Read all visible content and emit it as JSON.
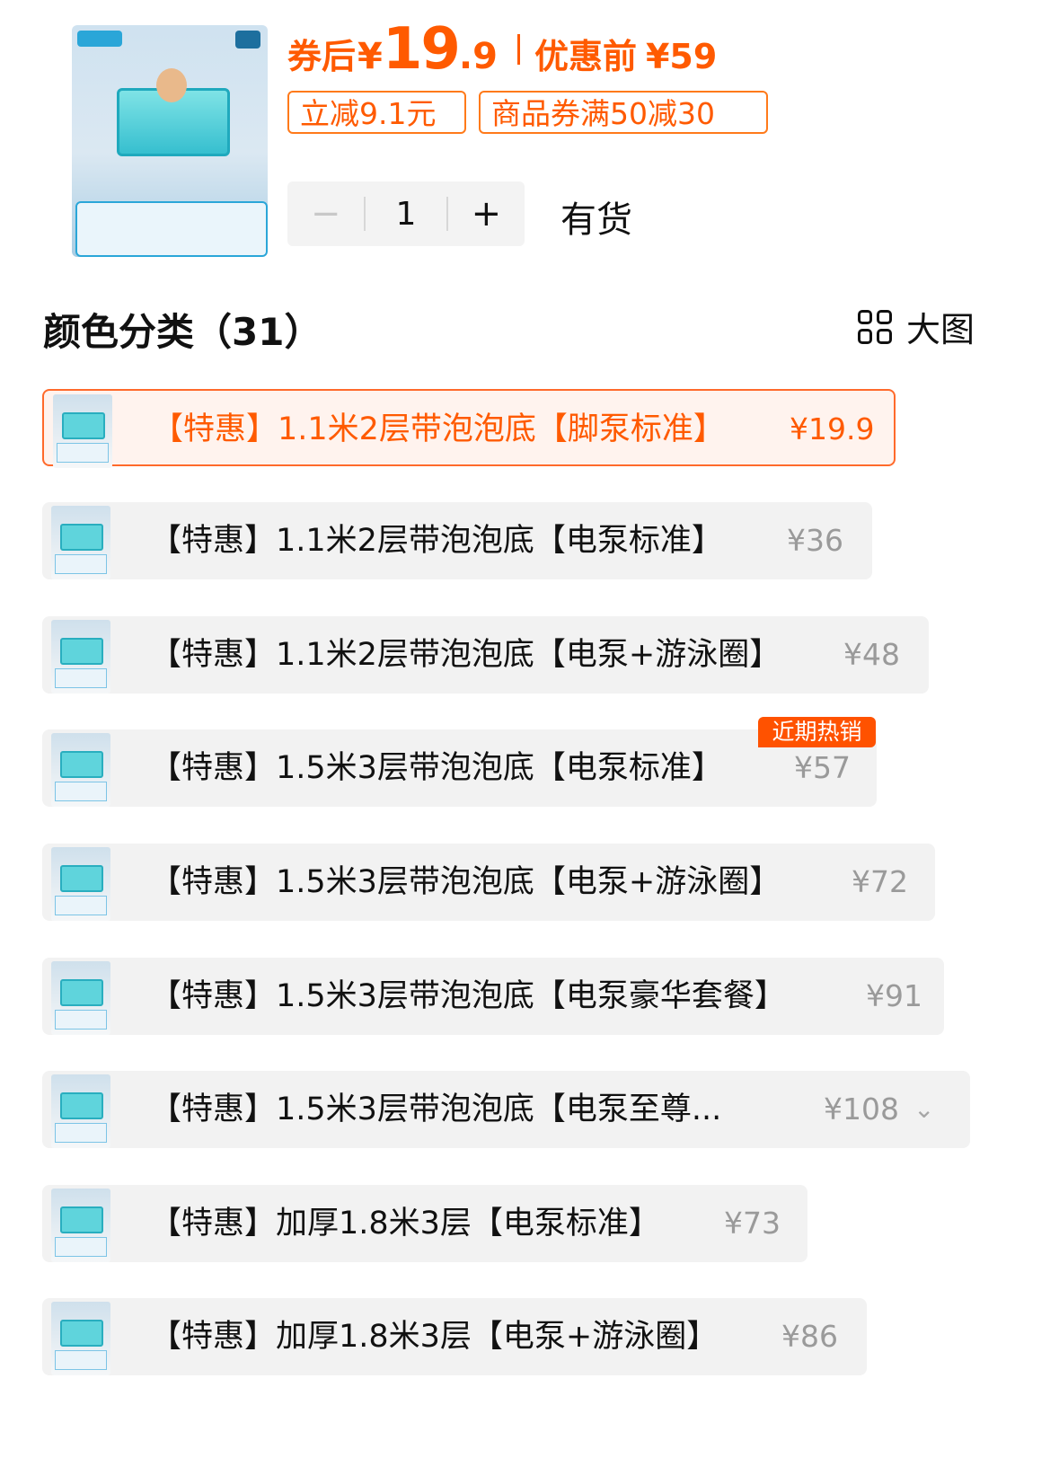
{
  "product": {
    "coupon_price_label": "券后",
    "currency": "¥",
    "coupon_price_int": "19",
    "coupon_price_dec": ".9",
    "original_price_label": "优惠前",
    "original_price": "¥59",
    "discounts": [
      "立减9.1元",
      "商品券满50减30"
    ],
    "quantity": "1",
    "minus_label": "−",
    "plus_label": "+",
    "stock_status": "有货"
  },
  "variants_section": {
    "title": "颜色分类（31）",
    "big_view_label": "大图"
  },
  "variants": [
    {
      "name": "【特惠】1.1米2层带泡泡底【脚泵标准】",
      "price": "¥19.9",
      "selected": true
    },
    {
      "name": "【特惠】1.1米2层带泡泡底【电泵标准】",
      "price": "¥36"
    },
    {
      "name": "【特惠】1.1米2层带泡泡底【电泵+游泳圈】",
      "price": "¥48"
    },
    {
      "name": "【特惠】1.5米3层带泡泡底【电泵标准】",
      "price": "¥57",
      "badge": "近期热销"
    },
    {
      "name": "【特惠】1.5米3层带泡泡底【电泵+游泳圈】",
      "price": "¥72"
    },
    {
      "name": "【特惠】1.5米3层带泡泡底【电泵豪华套餐】",
      "price": "¥91"
    },
    {
      "name": "【特惠】1.5米3层带泡泡底【电泵至尊...",
      "price": "¥108",
      "has_expand": true
    },
    {
      "name": "【特惠】加厚1.8米3层【电泵标准】",
      "price": "¥73"
    },
    {
      "name": "【特惠】加厚1.8米3层【电泵+游泳圈】",
      "price": "¥86"
    }
  ],
  "colors": {
    "accent": "#ff5a00",
    "selected_bg": "#fff3ee",
    "option_bg": "#f2f2f2",
    "muted_price": "#9a9a9a"
  }
}
